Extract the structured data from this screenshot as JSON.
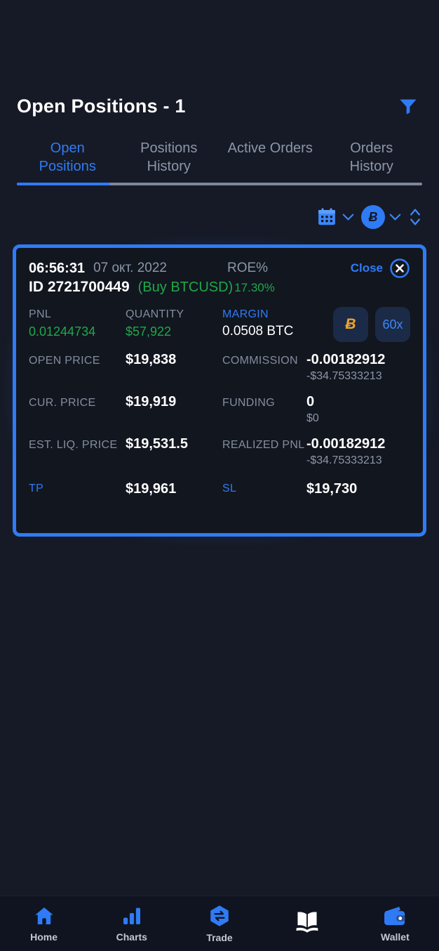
{
  "header": {
    "title": "Open Positions - 1",
    "filter_icon": "filter-funnel-icon"
  },
  "tabs": [
    {
      "line1": "Open",
      "line2": "Positions",
      "active": true
    },
    {
      "line1": "Positions",
      "line2": "History",
      "active": false
    },
    {
      "line1": "Active Orders",
      "line2": "",
      "active": false
    },
    {
      "line1": "Orders",
      "line2": "History",
      "active": false
    }
  ],
  "filters": {
    "calendar_icon": "calendar-icon",
    "calendar_chevron": "chevron-down-icon",
    "coin_symbol": "Ƀ",
    "coin_chevron": "chevron-down-icon",
    "sort_icon": "sort-updown-icon"
  },
  "position": {
    "time": "06:56:31",
    "date": "07 окт. 2022",
    "roe_label": "ROE%",
    "roe_value": "17.30%",
    "close_label": "Close",
    "close_icon": "close-circle-icon",
    "id": "ID 2721700449",
    "side": "(Buy BTCUSD)",
    "pnl_label": "PNL",
    "pnl_value": "0.01244734",
    "quantity_label": "QUANTITY",
    "quantity_value": "$57,922",
    "margin_label": "MARGIN",
    "margin_value": "0.0508 BTC",
    "coin_badge": "Ƀ",
    "leverage_badge": "60x",
    "open_price_label": "OPEN PRICE",
    "open_price_value": "$19,838",
    "commission_label": "COMMISSION",
    "commission_value": "-0.00182912",
    "commission_sub": "-$34.75333213",
    "cur_price_label": "CUR. PRICE",
    "cur_price_value": "$19,919",
    "funding_label": "FUNDING",
    "funding_value": "0",
    "funding_sub": "$0",
    "liq_price_label": "EST. LIQ. PRICE",
    "liq_price_value": "$19,531.5",
    "realized_pnl_label": "REALIZED PNL",
    "realized_pnl_value": "-0.00182912",
    "realized_pnl_sub": "-$34.75333213",
    "tp_label": "TP",
    "tp_value": "$19,961",
    "sl_label": "SL",
    "sl_value": "$19,730"
  },
  "nav": [
    {
      "label": "Home",
      "icon": "home-icon",
      "active": false
    },
    {
      "label": "Charts",
      "icon": "bar-chart-icon",
      "active": false
    },
    {
      "label": "Trade",
      "icon": "trade-swap-icon",
      "active": false
    },
    {
      "label": "",
      "icon": "open-book-icon",
      "active": true
    },
    {
      "label": "Wallet",
      "icon": "wallet-icon",
      "active": false
    }
  ],
  "colors": {
    "accent": "#2f7bf6",
    "positive": "#1fa84a",
    "background": "#161a26",
    "card": "#12161f",
    "muted": "#8c96a8",
    "btc_orange": "#f0a52a"
  }
}
